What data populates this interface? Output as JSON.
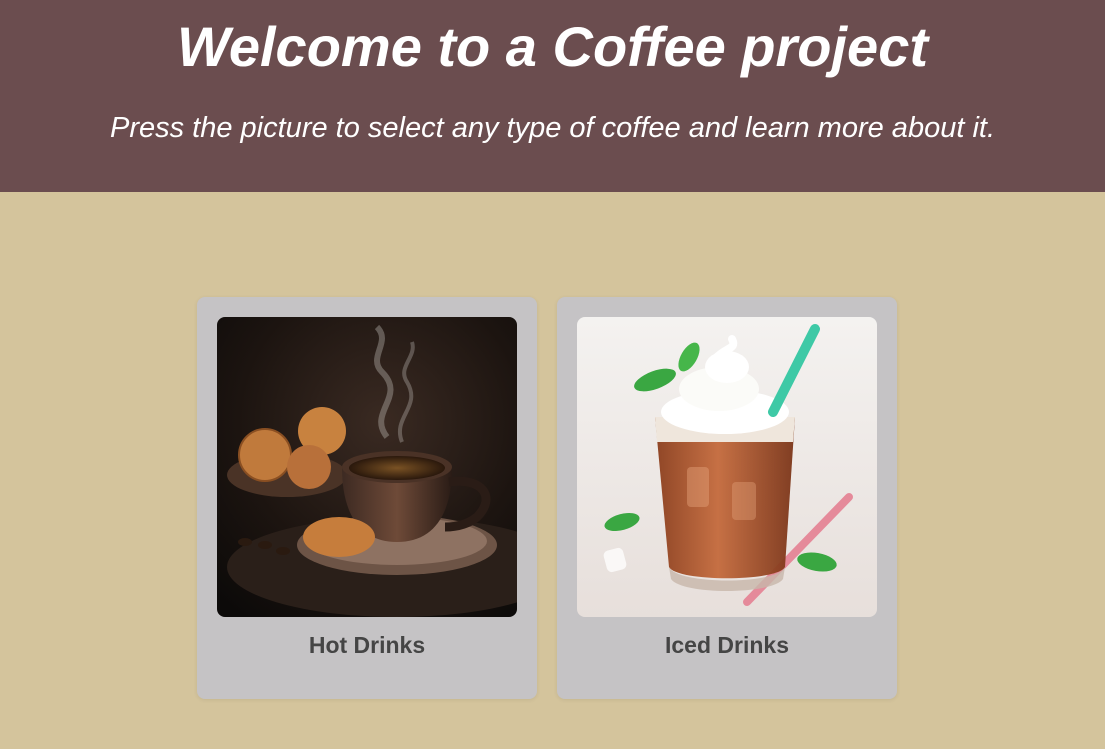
{
  "header": {
    "title": "Welcome to a Coffee project",
    "subtitle": "Press the picture to select any type of coffee and learn more about it."
  },
  "cards": [
    {
      "label": "Hot Drinks",
      "image_icon": "hot-coffee-cup-with-cookies"
    },
    {
      "label": "Iced Drinks",
      "image_icon": "iced-coffee-with-whipped-cream"
    }
  ],
  "colors": {
    "header_bg": "#6b4d4f",
    "page_bg": "#d4c49c",
    "card_bg": "#c5c3c5",
    "card_text": "#454545"
  }
}
